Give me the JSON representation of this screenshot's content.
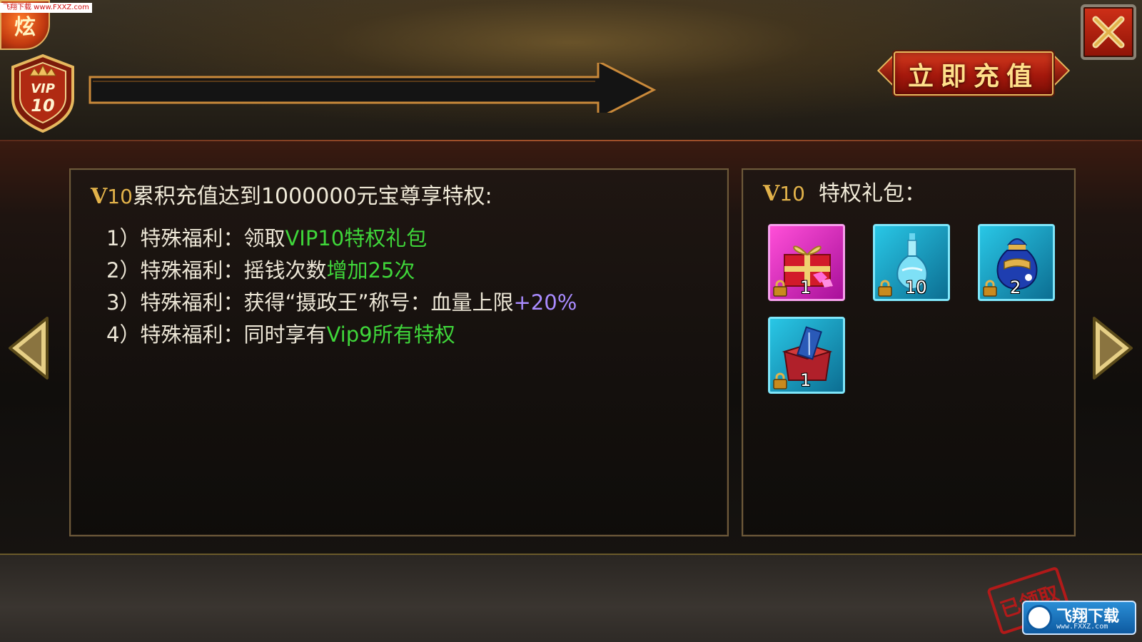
{
  "corner_badge": {
    "label": "炫"
  },
  "watermark_top": "飞翔下载 www.FXXZ.com",
  "vip_badge": {
    "label": "VIP",
    "level": "10"
  },
  "recharge_button": {
    "label": "立即充值"
  },
  "left_panel": {
    "title_v": "V",
    "title_level": "10",
    "title_text": "累积充值达到1000000元宝尊享特权:",
    "benefits": [
      {
        "prefix": "1）特殊福利：领取",
        "highlight": "VIP10特权礼包",
        "suffix": ""
      },
      {
        "prefix": "2）特殊福利：摇钱次数",
        "highlight": "增加25次",
        "suffix": ""
      },
      {
        "prefix": "3）特殊福利：获得“摄政王”称号：血量上限",
        "highlight": "+20%",
        "suffix": ""
      },
      {
        "prefix": "4）特殊福利：同时享有",
        "highlight": "Vip9所有特权",
        "suffix": ""
      }
    ]
  },
  "right_panel": {
    "title_v": "V",
    "title_level": "10",
    "title_text": "特权礼包：",
    "items": [
      {
        "icon": "gift-box-icon",
        "count": "1"
      },
      {
        "icon": "potion-bottle-icon",
        "count": "10"
      },
      {
        "icon": "money-bag-icon",
        "count": "2"
      },
      {
        "icon": "scroll-chest-icon",
        "count": "1"
      }
    ]
  },
  "stamp": {
    "label": "已领取"
  },
  "site_logo": {
    "text": "飞翔下载",
    "url": "www.FXXZ.com"
  },
  "colors": {
    "highlight_green": "#3fd63a",
    "highlight_purple": "#a98bff",
    "gold": "#e2b24a",
    "panel_border": "#6e5a3a"
  }
}
